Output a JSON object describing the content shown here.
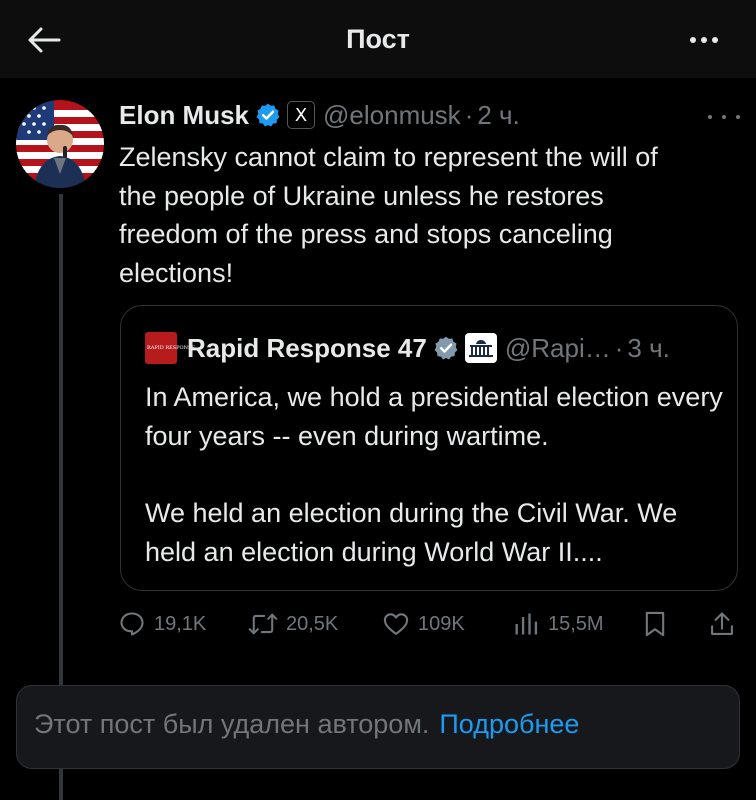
{
  "header": {
    "title": "Пост",
    "back_icon": "arrow-left-icon",
    "more_icon": "more-horizontal-icon"
  },
  "tweet": {
    "author_name": "Elon Musk",
    "handle": "@elonmusk",
    "separator": "·",
    "time": "2 ч.",
    "affiliate_badge": "X",
    "text_lines": [
      "Zelensky cannot claim to represent the will of",
      "the people of Ukraine unless he restores",
      "freedom of the press and stops canceling",
      "elections!"
    ]
  },
  "quote": {
    "logo_text": "RAPID RESPONSE",
    "author_name": "Rapid Response 47",
    "handle": "@Rapi…",
    "separator": "·",
    "time": "3 ч.",
    "paragraphs": [
      "In America, we hold a presidential election every four years -- even during wartime.",
      "We held an election during the Civil War. We held an election during World War II...."
    ]
  },
  "actions": {
    "replies": "19,1K",
    "reposts": "20,5K",
    "likes": "109K",
    "views": "15,5M"
  },
  "deleted_notice": {
    "text": "Этот пост был удален автором.",
    "link": "Подробнее"
  },
  "colors": {
    "background": "#000000",
    "text": "#e7e9ea",
    "muted": "#71767b",
    "accent": "#1d9bf0",
    "verified": "#1d9bf0",
    "border": "#2f3336"
  }
}
